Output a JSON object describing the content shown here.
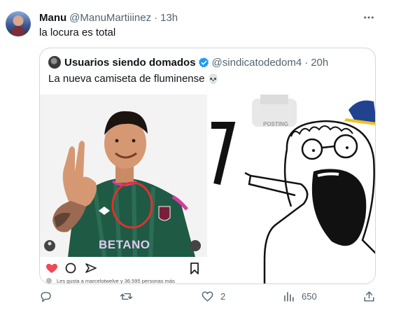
{
  "tweet": {
    "display_name": "Manu",
    "handle": "@ManuMartiiinez",
    "separator": "·",
    "time": "13h",
    "text": "la locura es total"
  },
  "quote": {
    "display_name": "Usuarios siendo domados",
    "handle": "@sindicatodedom4",
    "separator": "·",
    "time": "20h",
    "text": "La nueva camiseta de fluminense",
    "emoji": "💀",
    "media_left": {
      "sponsor": "BETANO",
      "likes_text": "Les gusta a marcelotwelve y 36.595 personas más"
    },
    "media_right": {
      "stamp_text": "POSTING"
    }
  },
  "actions": {
    "reply_count": "",
    "retweet_count": "",
    "like_count": "2",
    "views_count": "650"
  },
  "colors": {
    "text": "#0f1419",
    "muted": "#536471",
    "border": "#cfd9de",
    "verified": "#1d9bf0",
    "jersey_green": "#1f5a45",
    "jersey_pink": "#d63aa0",
    "circle_red": "#e0312f"
  },
  "icons": [
    "more-icon",
    "verified-badge-icon",
    "reply-icon",
    "retweet-icon",
    "like-icon",
    "views-icon",
    "share-icon"
  ]
}
